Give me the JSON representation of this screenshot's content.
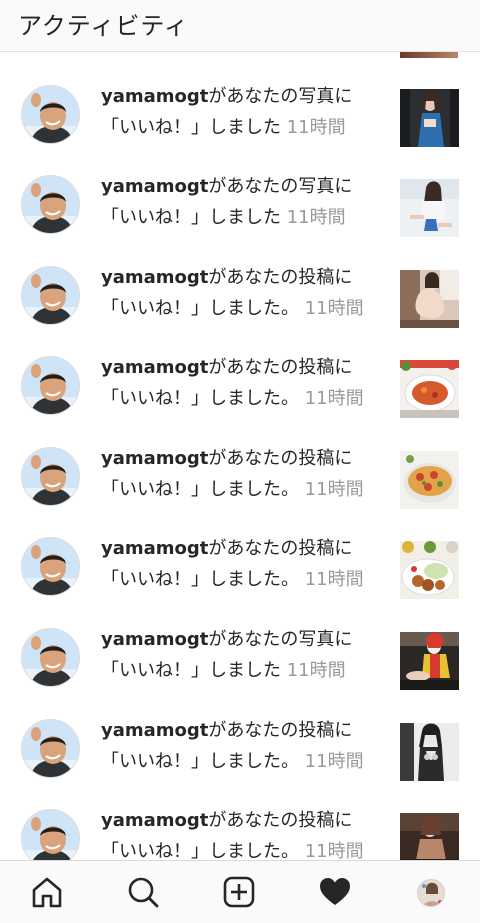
{
  "header": {
    "title": "アクティビティ"
  },
  "notifications": [
    {
      "user": "yamamogt",
      "text": "があなたの写真に「いいね！」しました",
      "time": "11時間",
      "thumb": "photo-woman-blue"
    },
    {
      "user": "yamamogt",
      "text": "があなたの写真に「いいね！」しました",
      "time": "11時間",
      "thumb": "photo-woman-swimsuit"
    },
    {
      "user": "yamamogt",
      "text": "があなたの投稿に「いいね！」しました。",
      "time": "11時間",
      "thumb": "photo-woman-room"
    },
    {
      "user": "yamamogt",
      "text": "があなたの投稿に「いいね！」しました。",
      "time": "11時間",
      "thumb": "photo-pasta"
    },
    {
      "user": "yamamogt",
      "text": "があなたの投稿に「いいね！」しました。",
      "time": "11時間",
      "thumb": "photo-pizza"
    },
    {
      "user": "yamamogt",
      "text": "があなたの投稿に「いいね！」しました。",
      "time": "11時間",
      "thumb": "photo-fried-food"
    },
    {
      "user": "yamamogt",
      "text": "があなたの写真に「いいね！」しました",
      "time": "11時間",
      "thumb": "photo-costume"
    },
    {
      "user": "yamamogt",
      "text": "があなたの投稿に「いいね！」しました。",
      "time": "11時間",
      "thumb": "photo-woman-mono"
    },
    {
      "user": "yamamogt",
      "text": "があなたの投稿に「いいね！」しました。",
      "time": "11時間",
      "thumb": "photo-woman-sofa"
    }
  ],
  "nav": {
    "items": [
      "home-icon",
      "search-icon",
      "new-post-icon",
      "activity-heart-icon",
      "profile-avatar"
    ],
    "active": "activity-heart-icon"
  },
  "colors": {
    "text": "#262626",
    "time": "#9a9a9a",
    "bar": "#fafafa",
    "border": "#dbdbdb"
  }
}
